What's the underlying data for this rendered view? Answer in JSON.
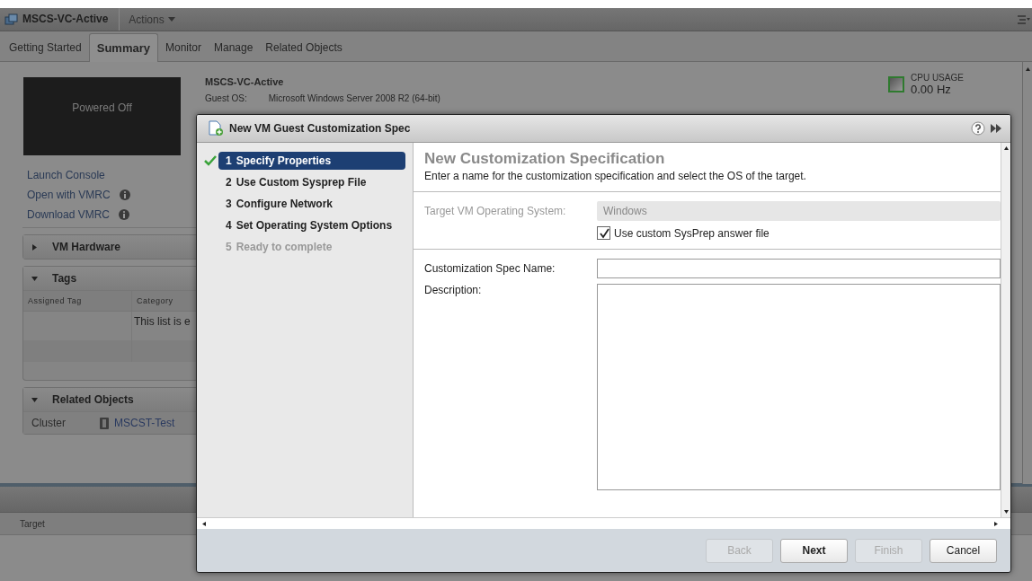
{
  "header": {
    "title": "MSCS-VC-Active",
    "menu": "Actions"
  },
  "tabs": [
    {
      "label": "Getting Started",
      "selected": false
    },
    {
      "label": "Summary",
      "selected": true
    },
    {
      "label": "Monitor",
      "selected": false
    },
    {
      "label": "Manage",
      "selected": false
    },
    {
      "label": "Related Objects",
      "selected": false
    }
  ],
  "vm": {
    "name": "MSCS-VC-Active",
    "guest_os_label": "Guest OS:",
    "guest_os_value": "Microsoft Windows Server 2008 R2 (64-bit)",
    "power_state": "Powered Off",
    "links": [
      {
        "label": "Launch Console",
        "info": false
      },
      {
        "label": "Open with VMRC",
        "info": true
      },
      {
        "label": "Download VMRC",
        "info": true
      }
    ]
  },
  "cpu": {
    "label": "CPU USAGE",
    "value": "0.00 Hz"
  },
  "panels": [
    {
      "title": "VM Hardware",
      "expanded": false
    },
    {
      "title": "Tags",
      "expanded": true,
      "columns": [
        "Assigned Tag",
        "Category"
      ],
      "empty_message": "This list is e"
    },
    {
      "title": "Related Objects",
      "expanded": true,
      "row": {
        "label": "Cluster",
        "value": "MSCST-Test"
      }
    }
  ],
  "bottom_table": {
    "columns": [
      "Target"
    ]
  },
  "dialog": {
    "title": "New VM Guest Customization Spec",
    "steps": [
      {
        "number": "1",
        "label": "Specify Properties",
        "selected": true,
        "completed": true,
        "disabled": false
      },
      {
        "number": "2",
        "label": "Use Custom Sysprep File",
        "selected": false,
        "completed": false,
        "disabled": false
      },
      {
        "number": "3",
        "label": "Configure Network",
        "selected": false,
        "completed": false,
        "disabled": false
      },
      {
        "number": "4",
        "label": "Set Operating System Options",
        "selected": false,
        "completed": false,
        "disabled": false
      },
      {
        "number": "5",
        "label": "Ready to complete",
        "selected": false,
        "completed": false,
        "disabled": true
      }
    ],
    "heading": "New Customization Specification",
    "description": "Enter a name for the customization specification and select the OS of the target.",
    "os_label": "Target VM Operating System:",
    "os_value": "Windows",
    "checkbox": {
      "label": "Use custom SysPrep answer file",
      "checked": true
    },
    "name_label": "Customization Spec Name:",
    "description_label": "Description:",
    "buttons": [
      {
        "label": "Back",
        "disabled": true,
        "primary": false
      },
      {
        "label": "Next",
        "disabled": false,
        "primary": true
      },
      {
        "label": "Finish",
        "disabled": true,
        "primary": false
      },
      {
        "label": "Cancel",
        "disabled": false,
        "primary": false
      }
    ]
  }
}
